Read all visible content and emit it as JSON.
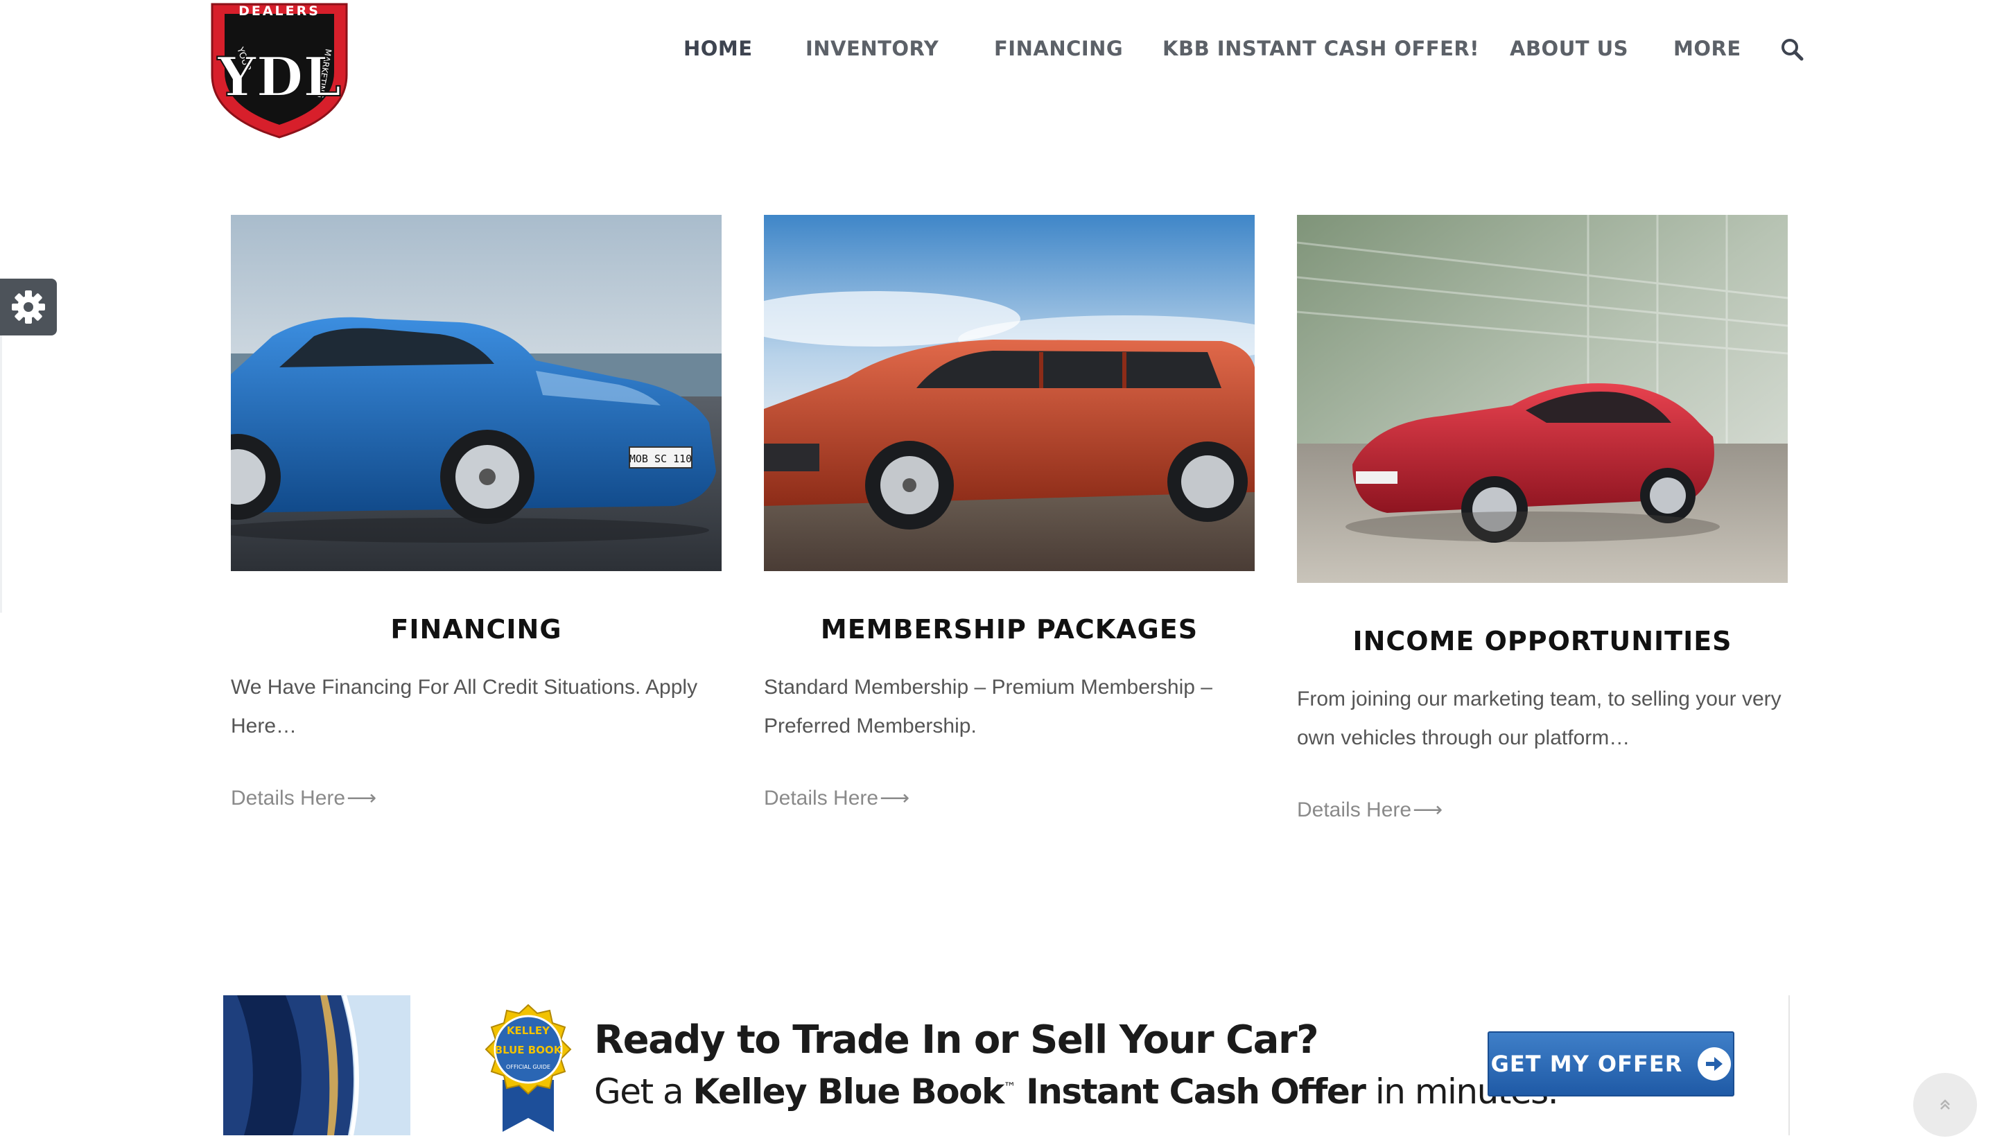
{
  "logo": {
    "arc_text": "DEALERS",
    "left_text": "YOUR",
    "right_text": "MARKETING",
    "monogram": "YDL"
  },
  "nav": {
    "items": [
      {
        "label": "HOME",
        "active": true
      },
      {
        "label": "INVENTORY"
      },
      {
        "label": "FINANCING"
      },
      {
        "label": "KBB INSTANT CASH OFFER!"
      },
      {
        "label": "ABOUT US"
      },
      {
        "label": "MORE"
      }
    ],
    "search_icon": "search-icon"
  },
  "settings": {
    "icon": "gear-icon"
  },
  "cards": [
    {
      "title": "FINANCING",
      "text": "We Have Financing For All Credit Situations. Apply Here…",
      "link": "Details Here",
      "plate": "MOB SC 110",
      "car_color": "#1c64b0"
    },
    {
      "title": "MEMBERSHIP PACKAGES",
      "text": "Standard Membership – Premium Membership – Preferred Membership.",
      "link": "Details Here",
      "car_color": "#c8452b"
    },
    {
      "title": "INCOME OPPORTUNITIES",
      "text": "From joining our marketing team, to selling your very own vehicles through our platform…",
      "link": "Details Here",
      "car_color": "#c42433"
    }
  ],
  "banner": {
    "badge_top": "KELLEY",
    "badge_mid": "BLUE BOOK",
    "badge_bottom": "OFFICIAL GUIDE",
    "title": "Ready to Trade In or Sell Your Car?",
    "sub_prefix": "Get a ",
    "sub_bold": "Kelley Blue Book",
    "sub_tm": "™",
    "sub_bold2": " Instant Cash Offer",
    "sub_suffix": " in minutes.",
    "button": "GET MY OFFER"
  },
  "to_top": {
    "icon": "double-chevron-up-icon"
  },
  "colors": {
    "nav_text": "#5c6168",
    "logo_red": "#d71f2b",
    "kbb_blue": "#2a66b4",
    "kbb_gold": "#f2c200"
  }
}
